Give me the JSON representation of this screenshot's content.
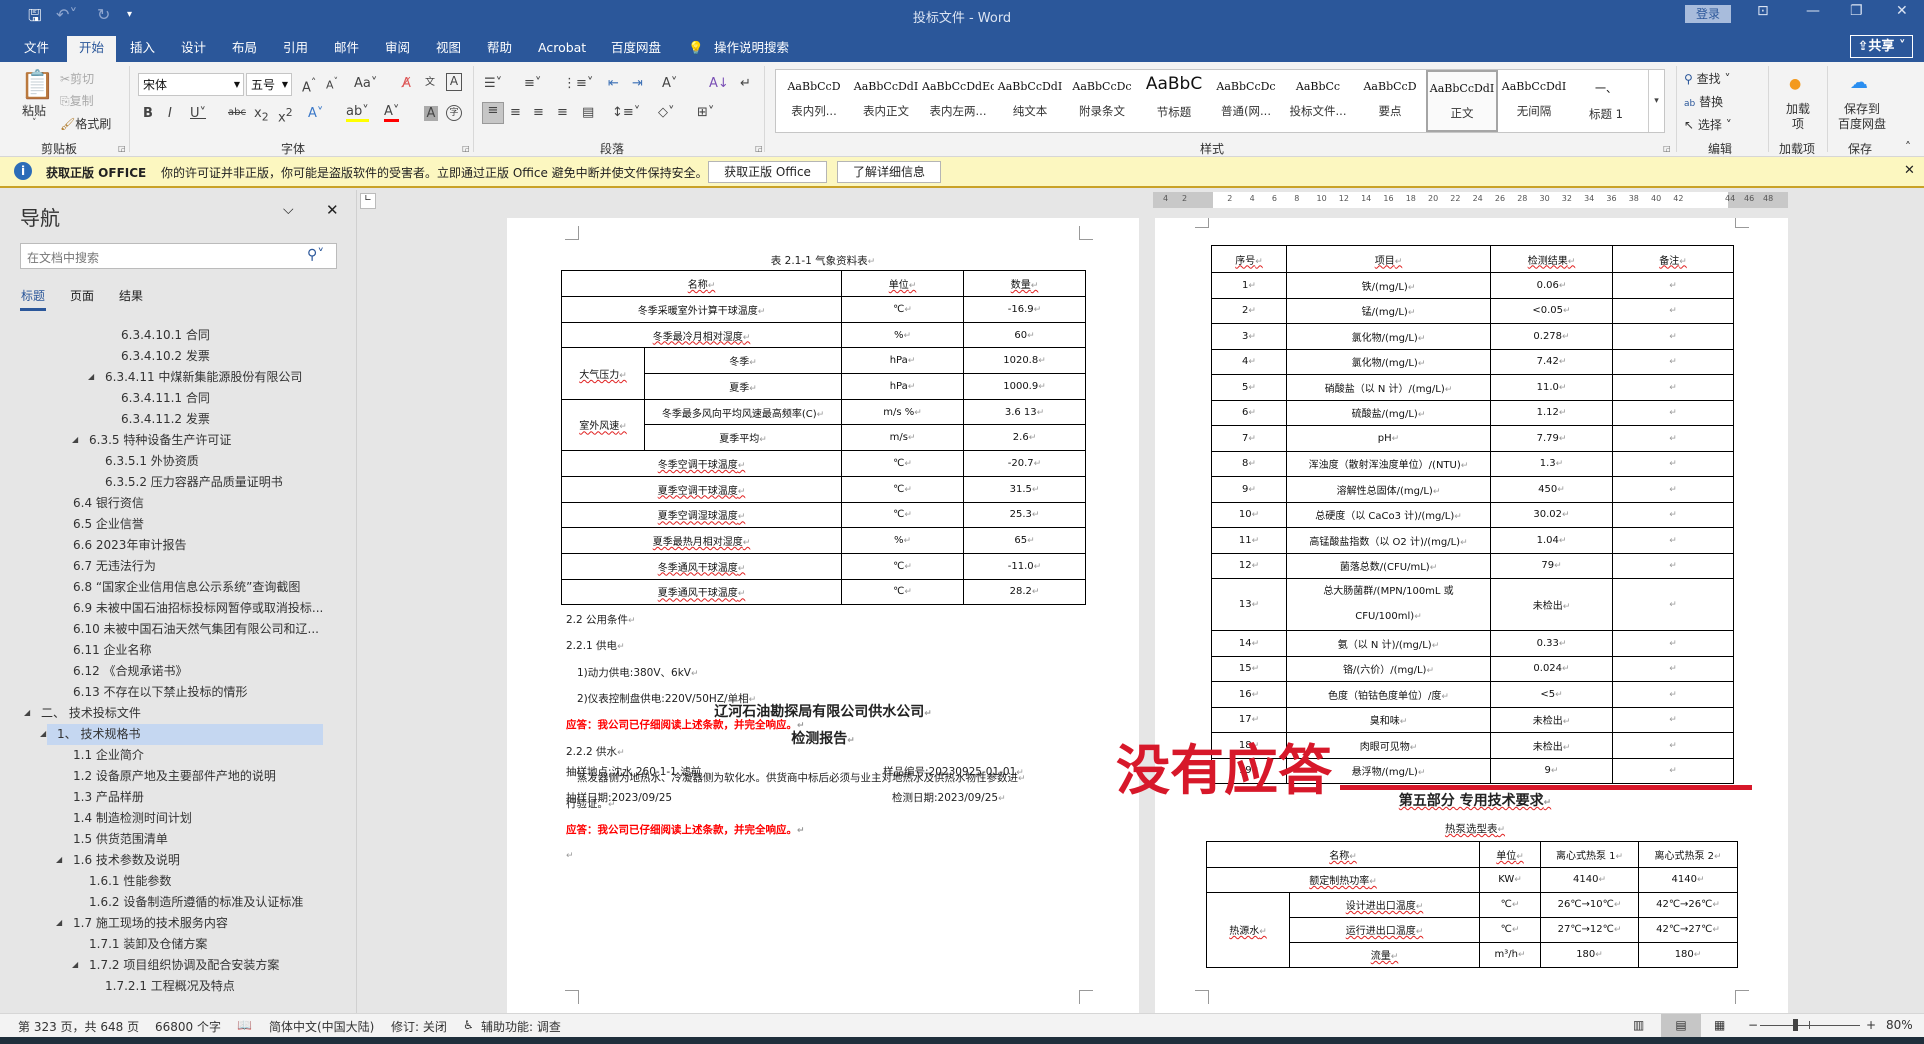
{
  "titlebar": {
    "doc_title": "投标文件 - Word",
    "login": "登录",
    "share": "共享",
    "icons": [
      "save-icon",
      "undo-icon",
      "redo-icon",
      "customize-icon"
    ]
  },
  "tabs": [
    "文件",
    "开始",
    "插入",
    "设计",
    "布局",
    "引用",
    "邮件",
    "审阅",
    "视图",
    "帮助",
    "Acrobat",
    "百度网盘"
  ],
  "tell_me": "操作说明搜索",
  "ribbon": {
    "clipboard": {
      "paste": "粘贴",
      "cut": "剪切",
      "copy": "复制",
      "format_painter": "格式刷",
      "label": "剪贴板"
    },
    "font": {
      "name": "宋体",
      "size": "五号",
      "label": "字体"
    },
    "paragraph": {
      "label": "段落"
    },
    "styles": {
      "label": "样式",
      "items": [
        {
          "preview": "AaBbCcD",
          "name": "表内列..."
        },
        {
          "preview": "AaBbCcDdI",
          "name": "表内正文"
        },
        {
          "preview": "AaBbCcDdEc",
          "name": "表内左两..."
        },
        {
          "preview": "AaBbCcDdI",
          "name": "纯文本"
        },
        {
          "preview": "AaBbCcDc",
          "name": "附录条文"
        },
        {
          "preview": "AaBbC",
          "name": "节标题"
        },
        {
          "preview": "AaBbCcDc",
          "name": "普通(网..."
        },
        {
          "preview": "AaBbCc",
          "name": "投标文件..."
        },
        {
          "preview": "AaBbCcD",
          "name": "要点"
        },
        {
          "preview": "AaBbCcDdI",
          "name": "正文"
        },
        {
          "preview": "AaBbCcDdI",
          "name": "无间隔"
        },
        {
          "preview": "一、",
          "name": "标题 1"
        }
      ],
      "selected": "正文"
    },
    "editing": {
      "find": "查找",
      "replace": "替换",
      "select": "选择",
      "label": "编辑"
    },
    "addins": {
      "button": "加载项",
      "label": "加载项"
    },
    "save": {
      "line1": "保存到",
      "line2": "百度网盘",
      "label": "保存"
    }
  },
  "infobar": {
    "title": "获取正版 OFFICE",
    "message": "你的许可证并非正版，你可能是盗版软件的受害者。立即通过正版 Office 避免中断并使文件保持安全。",
    "btn_get": "获取正版 Office",
    "btn_learn": "了解详细信息"
  },
  "nav": {
    "title": "导航",
    "search_placeholder": "在文档中搜索",
    "tabs": [
      "标题",
      "页面",
      "结果"
    ],
    "items": [
      {
        "text": "6.3.4.10.1 合同",
        "level": 5,
        "arrow": false
      },
      {
        "text": "6.3.4.10.2 发票",
        "level": 5,
        "arrow": false
      },
      {
        "text": "6.3.4.11 中煤新集能源股份有限公司",
        "level": 4,
        "arrow": true
      },
      {
        "text": "6.3.4.11.1 合同",
        "level": 5,
        "arrow": false
      },
      {
        "text": "6.3.4.11.2 发票",
        "level": 5,
        "arrow": false
      },
      {
        "text": "6.3.5 特种设备生产许可证",
        "level": 3,
        "arrow": true
      },
      {
        "text": "6.3.5.1 外协资质",
        "level": 4,
        "arrow": false
      },
      {
        "text": "6.3.5.2 压力容器产品质量证明书",
        "level": 4,
        "arrow": false
      },
      {
        "text": "6.4 银行资信",
        "level": 2,
        "arrow": false
      },
      {
        "text": "6.5 企业信誉",
        "level": 2,
        "arrow": false
      },
      {
        "text": "6.6 2023年审计报告",
        "level": 2,
        "arrow": false
      },
      {
        "text": "6.7 无违法行为",
        "level": 2,
        "arrow": false
      },
      {
        "text": "6.8 “国家企业信用信息公示系统”查询截图",
        "level": 2,
        "arrow": false
      },
      {
        "text": "6.9 未被中国石油招标投标网暂停或取消投标...",
        "level": 2,
        "arrow": false
      },
      {
        "text": "6.10 未被中国石油天然气集团有限公司和辽...",
        "level": 2,
        "arrow": false
      },
      {
        "text": "6.11 企业名称",
        "level": 2,
        "arrow": false
      },
      {
        "text": "6.12 《合规承诺书》",
        "level": 2,
        "arrow": false
      },
      {
        "text": "6.13 不存在以下禁止投标的情形",
        "level": 2,
        "arrow": false
      },
      {
        "text": "二、 技术投标文件",
        "level": 0,
        "arrow": true
      },
      {
        "text": "1、 技术规格书",
        "level": 1,
        "arrow": true,
        "selected": true
      },
      {
        "text": "1.1 企业简介",
        "level": 2,
        "arrow": false
      },
      {
        "text": "1.2 设备原产地及主要部件产地的说明",
        "level": 2,
        "arrow": false
      },
      {
        "text": "1.3 产品样册",
        "level": 2,
        "arrow": false
      },
      {
        "text": "1.4 制造检测时间计划",
        "level": 2,
        "arrow": false
      },
      {
        "text": "1.5 供货范围清单",
        "level": 2,
        "arrow": false
      },
      {
        "text": "1.6 技术参数及说明",
        "level": 2,
        "arrow": true
      },
      {
        "text": "1.6.1 性能参数",
        "level": 3,
        "arrow": false
      },
      {
        "text": "1.6.2 设备制造所遵循的标准及认证标准",
        "level": 3,
        "arrow": false
      },
      {
        "text": "1.7 施工现场的技术服务内容",
        "level": 2,
        "arrow": true
      },
      {
        "text": "1.7.1 装卸及仓储方案",
        "level": 3,
        "arrow": false
      },
      {
        "text": "1.7.2 项目组织协调及配合安装方案",
        "level": 3,
        "arrow": true
      },
      {
        "text": "1.7.2.1 工程概况及特点",
        "level": 4,
        "arrow": false
      }
    ]
  },
  "ruler": [
    "4",
    "2",
    "2",
    "4",
    "6",
    "8",
    "10",
    "12",
    "14",
    "16",
    "18",
    "20",
    "22",
    "24",
    "26",
    "28",
    "30",
    "32",
    "34",
    "36",
    "38",
    "40",
    "42",
    "44",
    "46",
    "48"
  ],
  "left_page": {
    "caption": "表 2.1-1 气象资料表",
    "header": [
      "名称",
      "单位",
      "数量"
    ],
    "rows": [
      {
        "group": "",
        "name": "冬季采暖室外计算干球温度",
        "unit": "℃",
        "value": "-16.9"
      },
      {
        "group": "",
        "name": "冬季最冷月相对湿度",
        "unit": "%",
        "value": "60"
      },
      {
        "group": "大气压力",
        "name": "冬季",
        "unit": "hPa",
        "value": "1020.8"
      },
      {
        "group": "大气压力",
        "name": "夏季",
        "unit": "hPa",
        "value": "1000.9"
      },
      {
        "group": "室外风速",
        "name": "冬季最多风向平均风速最高频率(C)",
        "unit": "m/s  %",
        "value": "3.6  13"
      },
      {
        "group": "室外风速",
        "name": "夏季平均",
        "unit": "m/s",
        "value": "2.6"
      },
      {
        "group": "",
        "name": "冬季空调干球温度",
        "unit": "℃",
        "value": "-20.7"
      },
      {
        "group": "",
        "name": "夏季空调干球温度",
        "unit": "℃",
        "value": "31.5"
      },
      {
        "group": "",
        "name": "夏季空调湿球温度",
        "unit": "℃",
        "value": "25.3"
      },
      {
        "group": "",
        "name": "夏季最热月相对湿度",
        "unit": "%",
        "value": "65"
      },
      {
        "group": "",
        "name": "冬季通风干球温度",
        "unit": "℃",
        "value": "-11.0"
      },
      {
        "group": "",
        "name": "夏季通风干球温度",
        "unit": "℃",
        "value": "28.2"
      }
    ],
    "paragraphs": [
      {
        "text": "2.2 公用条件",
        "style": "normal"
      },
      {
        "text": "2.2.1 供电",
        "style": "normal"
      },
      {
        "text": "1)动力供电:380V、6kV",
        "style": "indent"
      },
      {
        "text": "2)仪表控制盘供电:220V/50HZ/单相",
        "style": "indent"
      },
      {
        "text": "应答：我公司已仔细阅读上述条款，并完全响应。",
        "style": "red"
      },
      {
        "text": "2.2.2 供水",
        "style": "normal"
      },
      {
        "text": "蒸发器侧为地热水、冷凝器侧为软化水。供货商中标后必须与业主对地热水及供热水物性参数进",
        "style": "indent"
      },
      {
        "text": "行验证。",
        "style": "normal"
      },
      {
        "text": "应答：我公司已仔细阅读上述条款，并完全响应。",
        "style": "red"
      },
      {
        "text": "",
        "style": "normal"
      }
    ],
    "report_company": "辽河石油勘探局有限公司供水公司",
    "report_title": "检测报告",
    "sample_location": "抽样地点:沈水 260-1-1 滤前",
    "sample_id": "样品编号:20230925-01-01",
    "sample_date": "抽样日期:2023/09/25",
    "test_date": "检测日期:2023/09/25"
  },
  "right_page": {
    "header": [
      "序号",
      "项目",
      "检测结果",
      "备注"
    ],
    "rows": [
      {
        "no": "1",
        "item": "铁/(mg/L)",
        "result": "0.06",
        "note": ""
      },
      {
        "no": "2",
        "item": "锰/(mg/L)",
        "result": "<0.05",
        "note": ""
      },
      {
        "no": "3",
        "item": "氯化物/(mg/L)",
        "result": "0.278",
        "note": ""
      },
      {
        "no": "4",
        "item": "氯化物/(mg/L)",
        "result": "7.42",
        "note": ""
      },
      {
        "no": "5",
        "item": "硝酸盐（以 N 计）/(mg/L)",
        "result": "11.0",
        "note": ""
      },
      {
        "no": "6",
        "item": "硫酸盐/(mg/L)",
        "result": "1.12",
        "note": ""
      },
      {
        "no": "7",
        "item": "pH",
        "result": "7.79",
        "note": ""
      },
      {
        "no": "8",
        "item": "浑浊度（散射浑浊度单位）/(NTU)",
        "result": "1.3",
        "note": ""
      },
      {
        "no": "9",
        "item": "溶解性总固体/(mg/L)",
        "result": "450",
        "note": ""
      },
      {
        "no": "10",
        "item": "总硬度（以 CaCo3 计)/(mg/L)",
        "result": "30.02",
        "note": ""
      },
      {
        "no": "11",
        "item": "高锰酸盐指数（以 O2 计)/(mg/L)",
        "result": "1.04",
        "note": ""
      },
      {
        "no": "12",
        "item": "菌落总数/(CFU/mL)",
        "result": "79",
        "note": ""
      },
      {
        "no": "13",
        "item": "总大肠菌群/(MPN/100mL 或 CFU/100ml)",
        "result": "未检出",
        "note": "",
        "tall": true
      },
      {
        "no": "14",
        "item": "氨（以 N 计)/(mg/L)",
        "result": "0.33",
        "note": ""
      },
      {
        "no": "15",
        "item": "铬/(六价）/(mg/L)",
        "result": "0.024",
        "note": ""
      },
      {
        "no": "16",
        "item": "色度（铂钴色度单位）/度",
        "result": "<5",
        "note": ""
      },
      {
        "no": "17",
        "item": "臭和味",
        "result": "未检出",
        "note": ""
      },
      {
        "no": "18",
        "item": "肉眼可见物",
        "result": "未检出",
        "note": ""
      },
      {
        "no": "19",
        "item": "悬浮物/(mg/L)",
        "result": "9",
        "note": ""
      }
    ],
    "section_heading": "第五部分  专用技术要求",
    "pump_caption": "热泵选型表",
    "pump_header": [
      "名称",
      "单位",
      "离心式热泵 1",
      "离心式热泵 2"
    ],
    "pump_rows": [
      {
        "group": "",
        "name": "额定制热功率",
        "unit": "KW",
        "v1": "4140",
        "v2": "4140"
      },
      {
        "group": "热源水",
        "name": "设计进出口温度",
        "unit": "℃",
        "v1": "26℃→10℃",
        "v2": "42℃→26℃"
      },
      {
        "group": "热源水",
        "name": "运行进出口温度",
        "unit": "℃",
        "v1": "27℃→12℃",
        "v2": "42℃→27℃"
      },
      {
        "group": "热源水",
        "name": "流量",
        "unit": "m³/h",
        "v1": "180",
        "v2": "180"
      }
    ]
  },
  "annotation": {
    "text": "没有应答",
    "color": "#d7182a"
  },
  "statusbar": {
    "page": "第 323 页，共 648 页",
    "words": "66800 个字",
    "language": "简体中文(中国大陆)",
    "track": "修订: 关闭",
    "accessibility": "辅助功能: 调查",
    "zoom": "80%",
    "zoom_value": 80
  }
}
